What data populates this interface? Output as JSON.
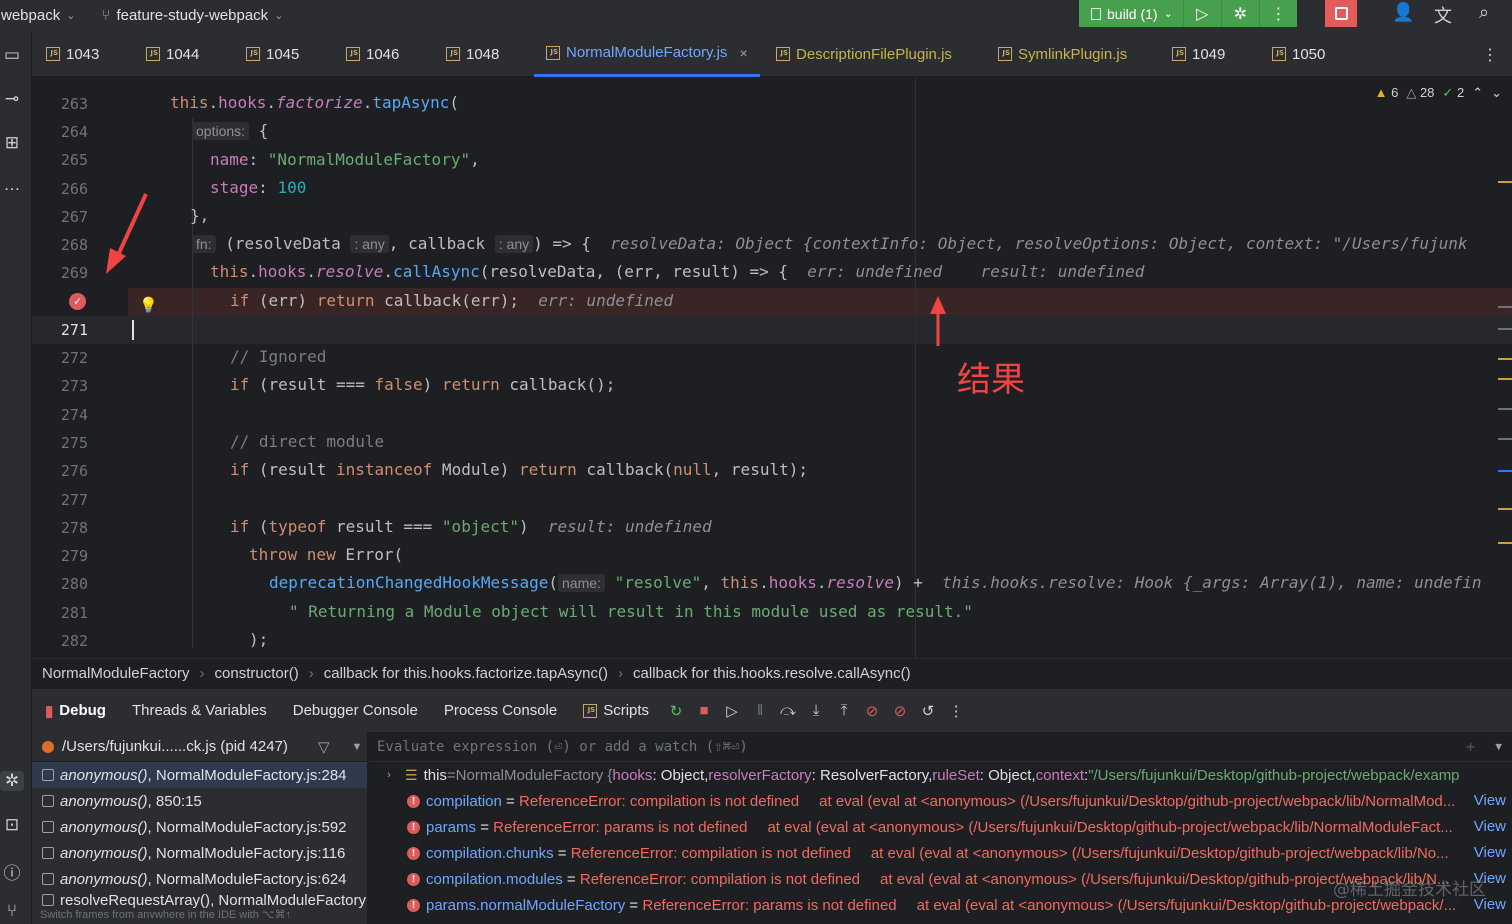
{
  "topbar": {
    "project": "webpack",
    "branch": "feature-study-webpack",
    "run_config": "build (1)"
  },
  "tabs": [
    {
      "label": "1043"
    },
    {
      "label": "1044"
    },
    {
      "label": "1045"
    },
    {
      "label": "1046"
    },
    {
      "label": "1048"
    },
    {
      "label": "NormalModuleFactory.js"
    },
    {
      "label": "DescriptionFilePlugin.js"
    },
    {
      "label": "SymlinkPlugin.js"
    },
    {
      "label": "1049"
    },
    {
      "label": "1050"
    }
  ],
  "inspections": {
    "warnings": "6",
    "weak_warnings": "28",
    "ok": "2"
  },
  "editor": {
    "lines": [
      "263",
      "264",
      "265",
      "266",
      "267",
      "268",
      "269",
      "270",
      "271",
      "272",
      "273",
      "274",
      "275",
      "276",
      "277",
      "278",
      "279",
      "280",
      "281",
      "282"
    ],
    "current_line": "271",
    "hints": {
      "options": "options:",
      "fn": "fn:",
      "any1": ": any",
      "any2": ": any",
      "name": "name:"
    },
    "inline_values": {
      "l268": "resolveData: Object {contextInfo: Object, resolveOptions: Object, context: \"/Users/fujunk",
      "l269a": "err: undefined",
      "l269b": "result: undefined",
      "l270": "err: undefined",
      "l278": "result: undefined",
      "l280": "this.hooks.resolve: Hook {_args: Array(1), name: undefin"
    },
    "code": {
      "l265_str": "\"NormalModuleFactory\"",
      "l266_num": "100",
      "l272_cmt": "// Ignored",
      "l275_cmt": "// direct module",
      "l278_str": "\"object\"",
      "l280_str": "\"resolve\"",
      "l281_str": "\" Returning a Module object will result in this module used as result.\""
    }
  },
  "annotation": {
    "label": "结果",
    "color": "#ef4444"
  },
  "breadcrumbs": [
    "NormalModuleFactory",
    "constructor()",
    "callback for this.hooks.factorize.tapAsync()",
    "callback for this.hooks.resolve.callAsync()"
  ],
  "debug": {
    "title": "Debug",
    "tabs": [
      "Threads & Variables",
      "Debugger Console",
      "Process Console",
      "Scripts"
    ]
  },
  "process": {
    "label": "/Users/fujunkui......ck.js (pid 4247)"
  },
  "frames": [
    {
      "fn": "anonymous()",
      "loc": ", NormalModuleFactory.js:284"
    },
    {
      "fn": "anonymous()",
      "loc": ", 850:15"
    },
    {
      "fn": "anonymous()",
      "loc": ", NormalModuleFactory.js:592"
    },
    {
      "fn": "anonymous()",
      "loc": ", NormalModuleFactory.js:116"
    },
    {
      "fn": "anonymous()",
      "loc": ", NormalModuleFactory.js:624"
    },
    {
      "fn": "resolveRequestArray()",
      "loc": ", NormalModuleFactory"
    }
  ],
  "frames_hint": "Switch frames from anywhere in the IDE with ⌥⌘↑",
  "eval_placeholder": "Evaluate expression (⏎) or add a watch (⇧⌘⏎)",
  "variables": {
    "this_row": {
      "name": "this",
      "eq": " = ",
      "type": "NormalModuleFactory {",
      "k1": "hooks",
      "v1": ": Object, ",
      "k2": "resolverFactory",
      "v2": ": ResolverFactory, ",
      "k3": "ruleSet",
      "v3": ": Object, ",
      "k4": "context",
      "v4": ": ",
      "s4": "\"/Users/fujunkui/Desktop/github-project/webpack/examp"
    },
    "errors": [
      {
        "name": "compilation",
        "msg": "ReferenceError: compilation is not defined",
        "trace": "at eval (eval at <anonymous> (/Users/fujunkui/Desktop/github-project/webpack/lib/NormalMod..."
      },
      {
        "name": "params",
        "msg": "ReferenceError: params is not defined",
        "trace": "at eval (eval at <anonymous> (/Users/fujunkui/Desktop/github-project/webpack/lib/NormalModuleFact..."
      },
      {
        "name": "compilation.chunks",
        "msg": "ReferenceError: compilation is not defined",
        "trace": "at eval (eval at <anonymous> (/Users/fujunkui/Desktop/github-project/webpack/lib/No..."
      },
      {
        "name": "compilation.modules",
        "msg": "ReferenceError: compilation is not defined",
        "trace": "at eval (eval at <anonymous> (/Users/fujunkui/Desktop/github-project/webpack/lib/N..."
      },
      {
        "name": "params.normalModuleFactory",
        "msg": "ReferenceError: params is not defined",
        "trace": "at eval (eval at <anonymous> (/Users/fujunkui/Desktop/github-project/webpack/..."
      }
    ],
    "view_label": "View"
  },
  "watermark": "@稀土掘金技术社区"
}
